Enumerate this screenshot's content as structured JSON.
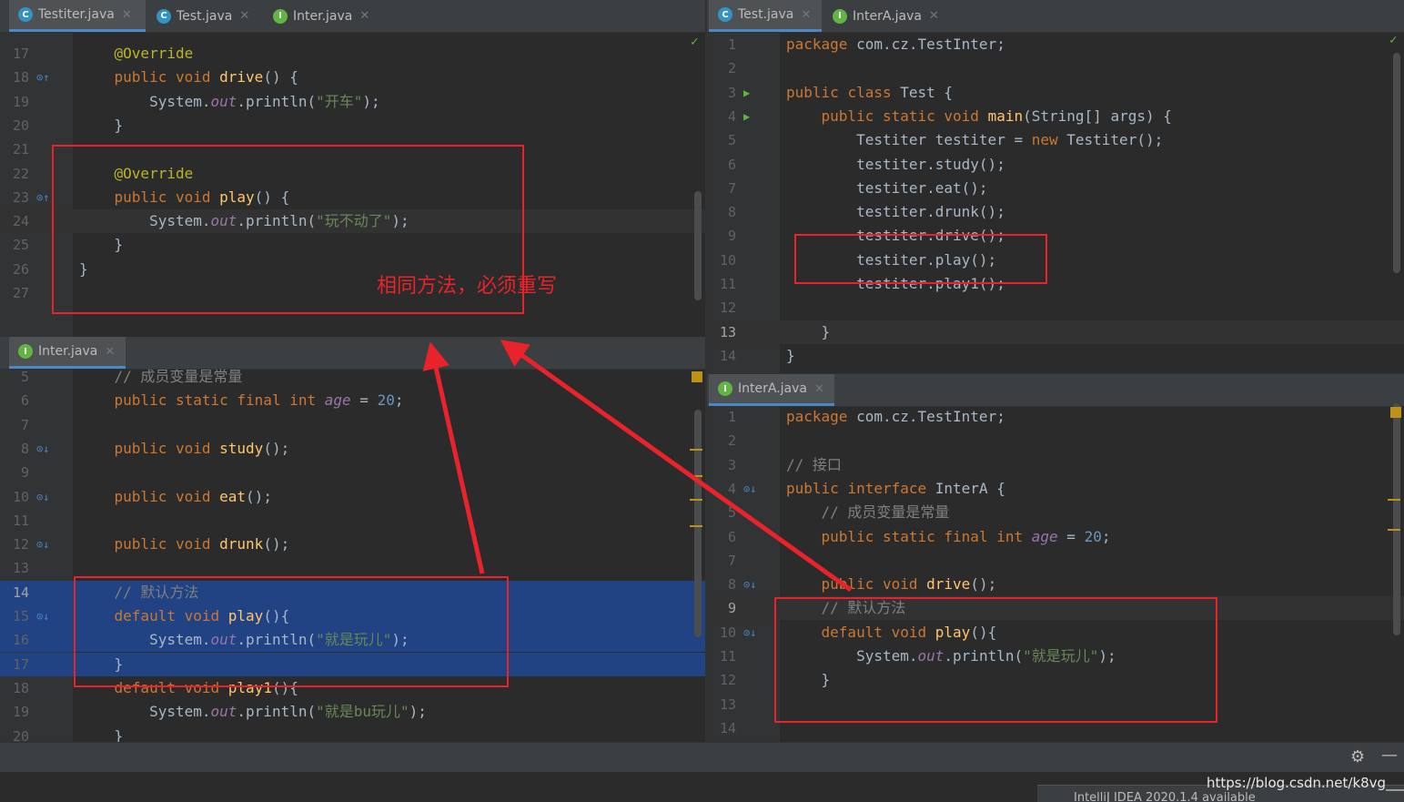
{
  "top_left": {
    "tabs": [
      {
        "label": "Testiter.java",
        "icon": "C"
      },
      {
        "label": "Test.java",
        "icon": "C"
      },
      {
        "label": "Inter.java",
        "icon": "I"
      }
    ],
    "lines": [
      {
        "n": "17",
        "code": "    @Override"
      },
      {
        "n": "18",
        "code": "    public void drive() {"
      },
      {
        "n": "19",
        "code": "        System.out.println(\"开车\");"
      },
      {
        "n": "20",
        "code": "    }"
      },
      {
        "n": "21",
        "code": ""
      },
      {
        "n": "22",
        "code": "    @Override"
      },
      {
        "n": "23",
        "code": "    public void play() {"
      },
      {
        "n": "24",
        "code": "        System.out.println(\"玩不动了\");"
      },
      {
        "n": "25",
        "code": "    }"
      },
      {
        "n": "26",
        "code": "}"
      },
      {
        "n": "27",
        "code": ""
      }
    ]
  },
  "bottom_left": {
    "tabs": [
      {
        "label": "Inter.java",
        "icon": "I"
      }
    ],
    "lines": [
      {
        "n": "5",
        "code": "    // 成员变量是常量"
      },
      {
        "n": "6",
        "code": "    public static final int age = 20;"
      },
      {
        "n": "7",
        "code": ""
      },
      {
        "n": "8",
        "code": "    public void study();"
      },
      {
        "n": "9",
        "code": ""
      },
      {
        "n": "10",
        "code": "    public void eat();"
      },
      {
        "n": "11",
        "code": ""
      },
      {
        "n": "12",
        "code": "    public void drunk();"
      },
      {
        "n": "13",
        "code": ""
      },
      {
        "n": "14",
        "code": "    // 默认方法"
      },
      {
        "n": "15",
        "code": "    default void play(){"
      },
      {
        "n": "16",
        "code": "        System.out.println(\"就是玩儿\");"
      },
      {
        "n": "17",
        "code": "    }"
      },
      {
        "n": "18",
        "code": "    default void play1(){"
      },
      {
        "n": "19",
        "code": "        System.out.println(\"就是bu玩儿\");"
      },
      {
        "n": "20",
        "code": "    }"
      }
    ]
  },
  "top_right": {
    "tabs": [
      {
        "label": "Test.java",
        "icon": "C"
      },
      {
        "label": "InterA.java",
        "icon": "I"
      }
    ],
    "lines": [
      {
        "n": "1",
        "code": "package com.cz.TestInter;"
      },
      {
        "n": "2",
        "code": ""
      },
      {
        "n": "3",
        "code": "public class Test {"
      },
      {
        "n": "4",
        "code": "    public static void main(String[] args) {"
      },
      {
        "n": "5",
        "code": "        Testiter testiter = new Testiter();"
      },
      {
        "n": "6",
        "code": "        testiter.study();"
      },
      {
        "n": "7",
        "code": "        testiter.eat();"
      },
      {
        "n": "8",
        "code": "        testiter.drunk();"
      },
      {
        "n": "9",
        "code": "        testiter.drive();"
      },
      {
        "n": "10",
        "code": "        testiter.play();"
      },
      {
        "n": "11",
        "code": "        testiter.play1();"
      },
      {
        "n": "12",
        "code": ""
      },
      {
        "n": "13",
        "code": "    }"
      },
      {
        "n": "14",
        "code": "}"
      }
    ]
  },
  "bottom_right": {
    "tabs": [
      {
        "label": "InterA.java",
        "icon": "I"
      }
    ],
    "lines": [
      {
        "n": "1",
        "code": "package com.cz.TestInter;"
      },
      {
        "n": "2",
        "code": ""
      },
      {
        "n": "3",
        "code": "// 接口"
      },
      {
        "n": "4",
        "code": "public interface InterA {"
      },
      {
        "n": "5",
        "code": "    // 成员变量是常量"
      },
      {
        "n": "6",
        "code": "    public static final int age = 20;"
      },
      {
        "n": "7",
        "code": ""
      },
      {
        "n": "8",
        "code": "    public void drive();"
      },
      {
        "n": "9",
        "code": "    // 默认方法"
      },
      {
        "n": "10",
        "code": "    default void play(){"
      },
      {
        "n": "11",
        "code": "        System.out.println(\"就是玩儿\");"
      },
      {
        "n": "12",
        "code": "    }"
      },
      {
        "n": "13",
        "code": ""
      },
      {
        "n": "14",
        "code": ""
      }
    ]
  },
  "annotation": {
    "text": "相同方法，必须重写",
    "color": "#e8232b"
  },
  "watermark": "https://blog.csdn.net/k8vg___",
  "notification_fragment": "IntelliJ IDEA 2020.1.4 available",
  "colors": {
    "bg": "#2b2b2b",
    "keyword": "#cc7832",
    "string": "#6a8759",
    "method": "#ffc66d",
    "annotation": "#bbb529",
    "field": "#9876aa",
    "number": "#6897bb",
    "comment": "#808080",
    "selection": "#214283"
  }
}
